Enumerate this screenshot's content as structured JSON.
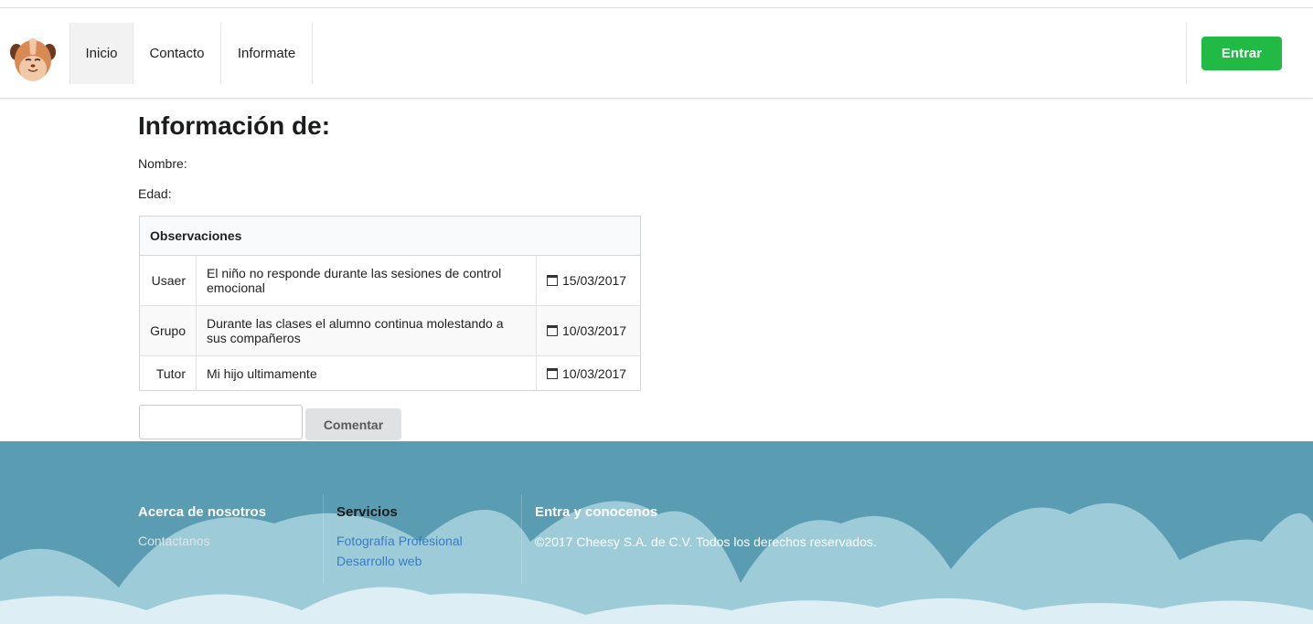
{
  "header": {
    "logo_icon": "guinea-pig-logo",
    "nav": [
      {
        "label": "Inicio",
        "active": true
      },
      {
        "label": "Contacto",
        "active": false
      },
      {
        "label": "Informate",
        "active": false
      }
    ],
    "login_button": "Entrar",
    "login_color": "#21ba45"
  },
  "main": {
    "title": "Información de:",
    "nombre_label": "Nombre:",
    "edad_label": "Edad:",
    "table": {
      "header": "Observaciones",
      "rows": [
        {
          "author": "Usaer",
          "message": "El niño no responde durante las sesiones de control emocional",
          "date": "15/03/2017",
          "icon": "calendar-icon"
        },
        {
          "author": "Grupo",
          "message": "Durante las clases el alumno continua molestando a sus compañeros",
          "date": "10/03/2017",
          "icon": "calendar-icon"
        },
        {
          "author": "Tutor",
          "message": "Mi hijo ultimamente",
          "date": "10/03/2017",
          "icon": "calendar-icon"
        }
      ]
    },
    "comment_placeholder": "",
    "comment_button": "Comentar"
  },
  "footer": {
    "background": "#5a9cb1",
    "col1": {
      "title": "Acerca de nosotros",
      "links": [
        "Contactanos"
      ]
    },
    "col2": {
      "title": "Servicios",
      "links": [
        "Fotografía Profesional",
        "Desarrollo web"
      ]
    },
    "col3": {
      "title": "Entra y conocenos",
      "text": "©2017 Cheesy S.A. de C.V. Todos los derechos reservados."
    }
  }
}
